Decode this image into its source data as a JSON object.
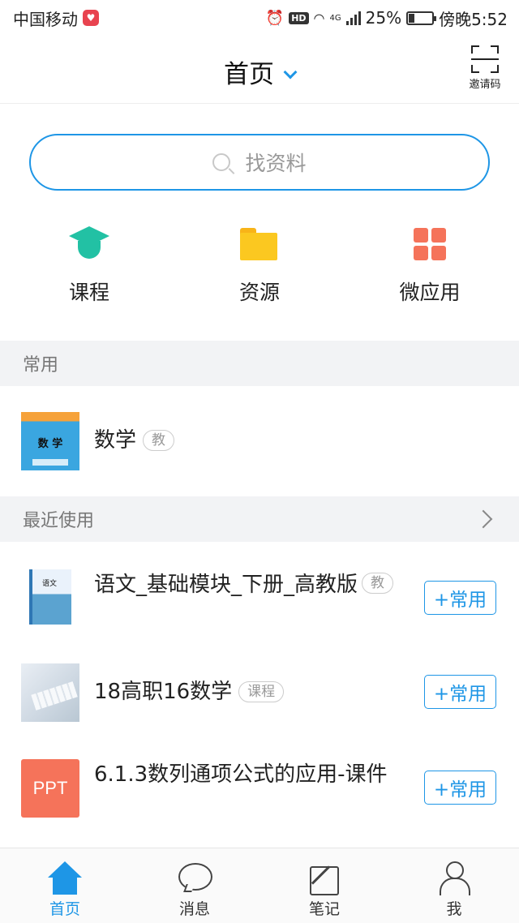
{
  "status_bar": {
    "carrier": "中国移动",
    "network": "4G",
    "hd": "HD",
    "battery_percent": "25%",
    "battery_level": 0.25,
    "time": "傍晚5:52"
  },
  "header": {
    "title": "首页",
    "invite_label": "邀请码"
  },
  "search": {
    "placeholder": "找资料"
  },
  "quick_entries": [
    {
      "label": "课程",
      "icon": "graduation-cap-icon",
      "color": "#22c1a4"
    },
    {
      "label": "资源",
      "icon": "folder-icon",
      "color": "#fbc820"
    },
    {
      "label": "微应用",
      "icon": "apps-grid-icon",
      "color": "#f5735a"
    }
  ],
  "sections": {
    "frequent": "常用",
    "recent": "最近使用"
  },
  "frequent_items": [
    {
      "title": "数学",
      "tag": "教",
      "cover_text": "数 学"
    }
  ],
  "recent_items": [
    {
      "title": "语文_基础模块_下册_高教版",
      "tag": "教",
      "action": "+常用",
      "cover_text": "语文"
    },
    {
      "title": "18高职16数学",
      "tag": "课程",
      "action": "+常用"
    },
    {
      "title": "6.1.3数列通项公式的应用-课件",
      "thumb_text": "PPT",
      "action": "+常用"
    }
  ],
  "bottom_nav": [
    {
      "label": "首页",
      "icon": "home-icon",
      "active": true
    },
    {
      "label": "消息",
      "icon": "chat-bubble-icon",
      "active": false
    },
    {
      "label": "笔记",
      "icon": "note-edit-icon",
      "active": false
    },
    {
      "label": "我",
      "icon": "person-icon",
      "active": false
    }
  ],
  "colors": {
    "accent": "#1e96e6",
    "course_green": "#22c1a4",
    "folder_yellow": "#fbc820",
    "apps_orange": "#f5735a",
    "section_bg": "#f2f3f5"
  }
}
